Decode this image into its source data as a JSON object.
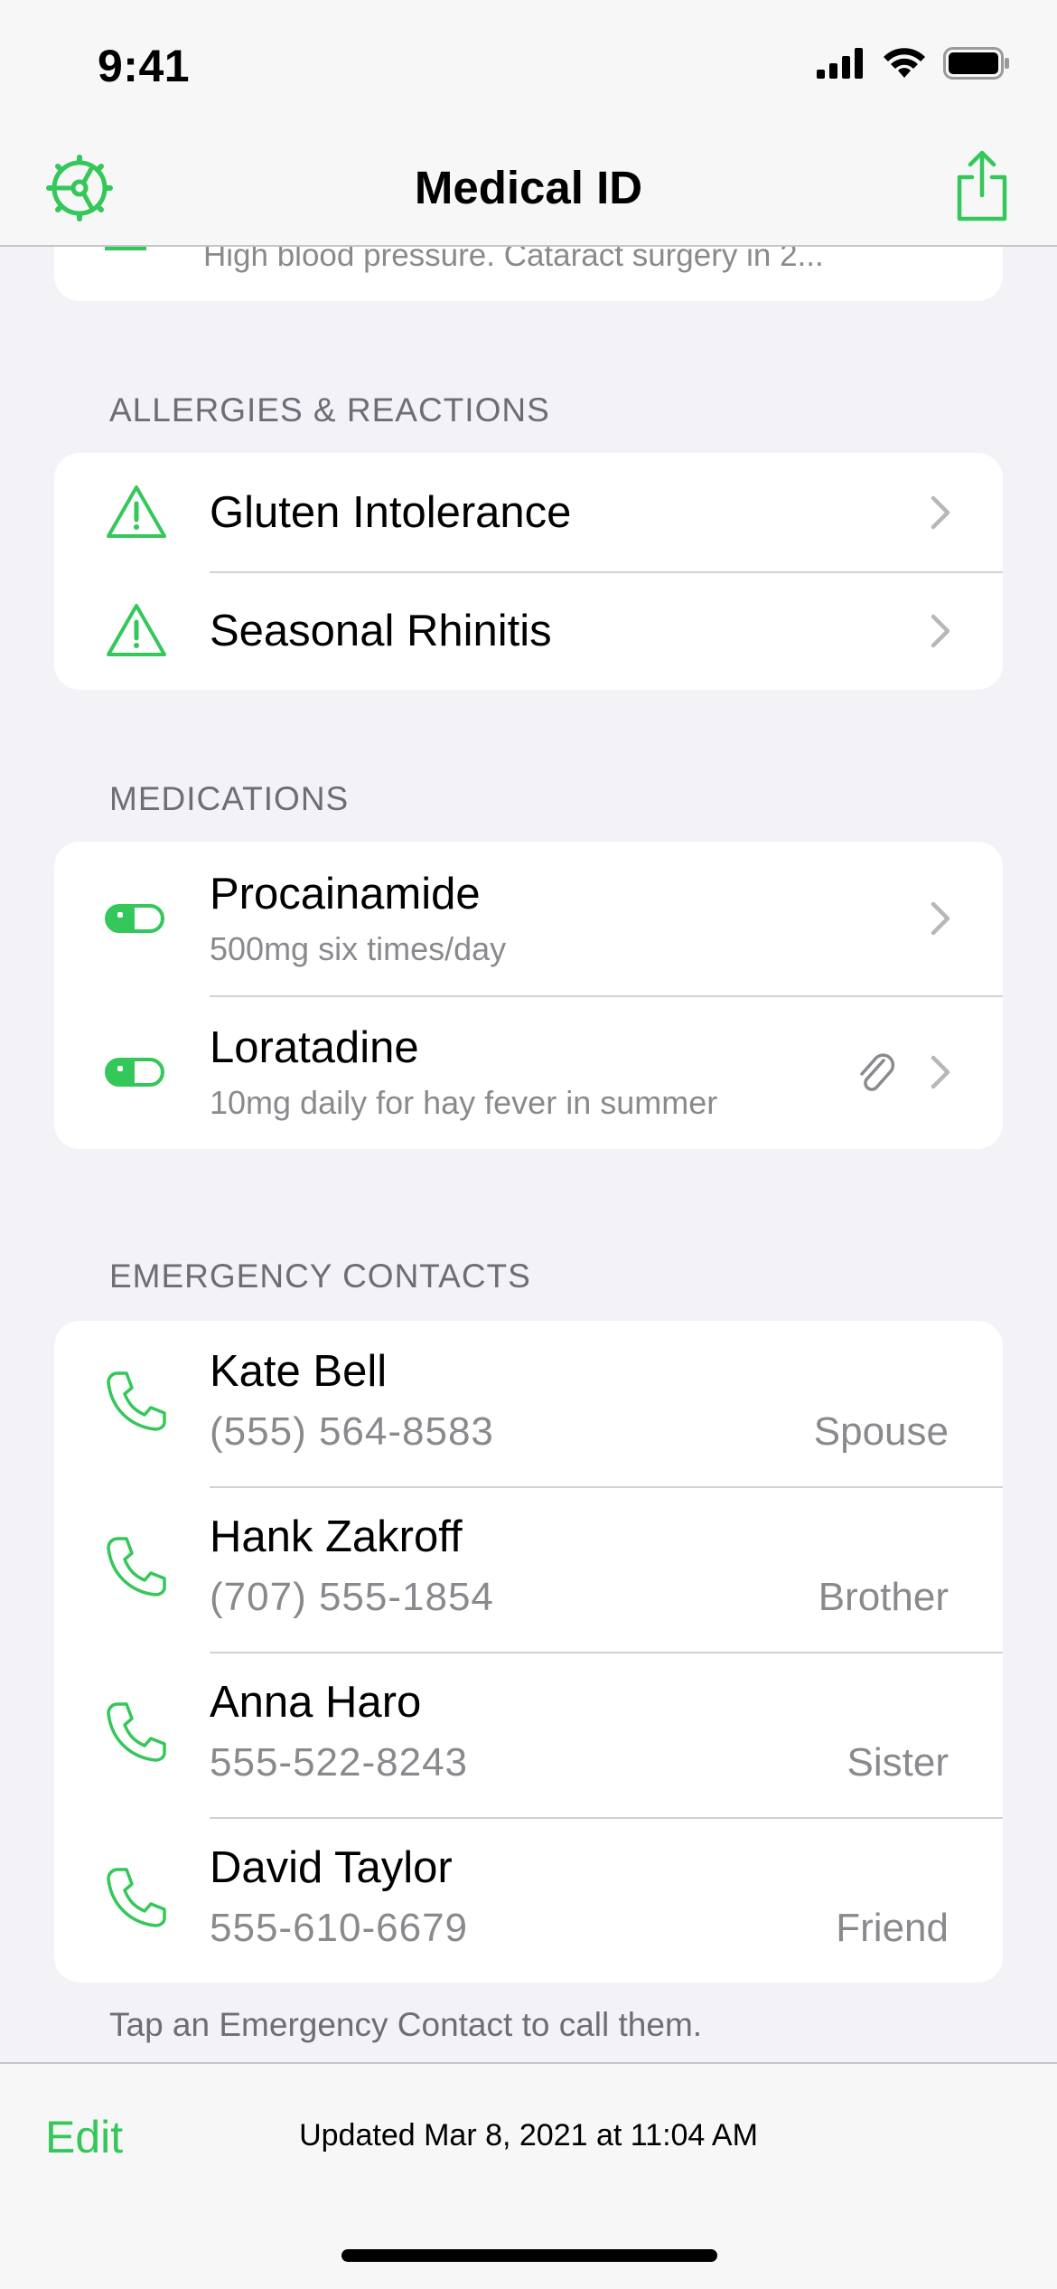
{
  "status_bar": {
    "time": "9:41"
  },
  "nav": {
    "title": "Medical ID"
  },
  "conditions_card": {
    "partial_text": "High blood pressure. Cataract surgery in 2..."
  },
  "allergies": {
    "header": "ALLERGIES & REACTIONS",
    "items": [
      {
        "label": "Gluten Intolerance"
      },
      {
        "label": "Seasonal Rhinitis"
      }
    ]
  },
  "medications": {
    "header": "MEDICATIONS",
    "items": [
      {
        "name": "Procainamide",
        "detail": "500mg six times/day"
      },
      {
        "name": "Loratadine",
        "detail": "10mg daily for hay fever in summer"
      }
    ]
  },
  "contacts": {
    "header": "EMERGENCY CONTACTS",
    "items": [
      {
        "name": "Kate Bell",
        "phone": "(555) 564-8583",
        "relation": "Spouse"
      },
      {
        "name": "Hank Zakroff",
        "phone": "(707) 555-1854",
        "relation": "Brother"
      },
      {
        "name": "Anna Haro",
        "phone": "555-522-8243",
        "relation": "Sister"
      },
      {
        "name": "David Taylor",
        "phone": "555-610-6679",
        "relation": "Friend"
      }
    ],
    "footer": "Tap an Emergency Contact to call them."
  },
  "toolbar": {
    "edit_label": "Edit",
    "updated_text": "Updated Mar 8, 2021 at 11:04 AM"
  },
  "colors": {
    "accent": "#34c759",
    "secondary_text": "#8a8a8e",
    "background": "#f2f2f7"
  },
  "icons": {
    "nav_left": "steering-wheel-icon",
    "nav_right": "share-icon",
    "allergy": "warning-triangle-icon",
    "medication": "pill-icon",
    "contact": "phone-icon",
    "attachment": "paperclip-icon",
    "chevron": "chevron-right-icon"
  }
}
